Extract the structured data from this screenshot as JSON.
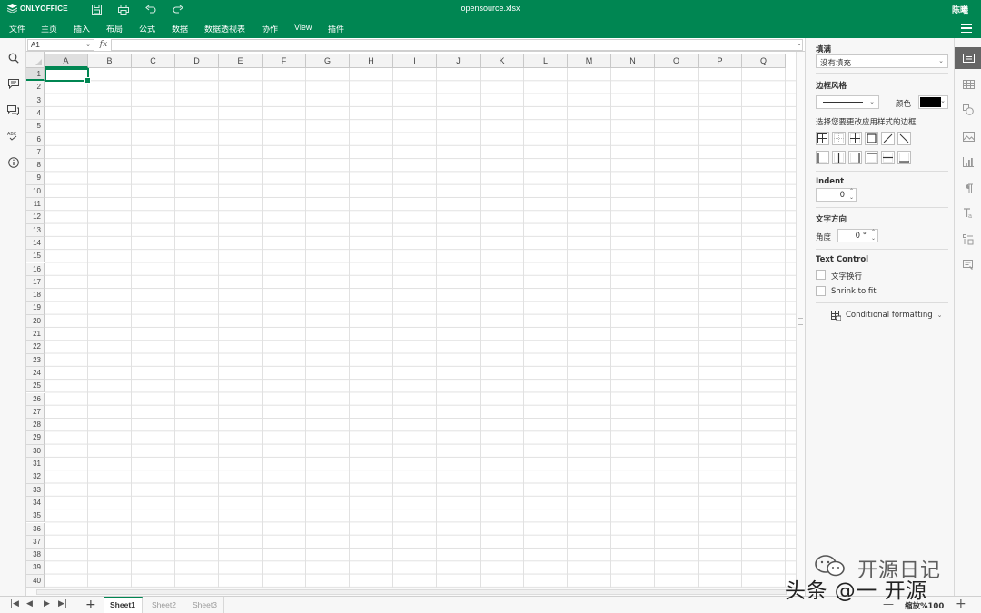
{
  "app": {
    "logo_text": "ONLYOFFICE",
    "doc_title": "opensource.xlsx",
    "user_name": "陈曦",
    "brand_color": "#008652"
  },
  "menu": {
    "items": [
      "文件",
      "主页",
      "插入",
      "布局",
      "公式",
      "数据",
      "数据透视表",
      "协作",
      "View",
      "插件"
    ]
  },
  "formula_bar": {
    "cell_ref": "A1",
    "fx_label": "fx",
    "formula": ""
  },
  "grid": {
    "columns": [
      "A",
      "B",
      "C",
      "D",
      "E",
      "F",
      "G",
      "H",
      "I",
      "J",
      "K",
      "L",
      "M",
      "N",
      "O",
      "P",
      "Q"
    ],
    "rows": [
      "1",
      "2",
      "3",
      "4",
      "5",
      "6",
      "7",
      "8",
      "9",
      "10",
      "11",
      "12",
      "13",
      "14",
      "15",
      "16",
      "17",
      "18",
      "19",
      "20",
      "21",
      "22",
      "23",
      "24",
      "25",
      "26",
      "27",
      "28",
      "29",
      "30",
      "31",
      "32",
      "33",
      "34",
      "35",
      "36",
      "37",
      "38",
      "39",
      "40"
    ],
    "selected_cell": "A1"
  },
  "right_panel": {
    "fill_label": "填满",
    "fill_value": "没有填充",
    "border_style_label": "边框风格",
    "color_label": "颜色",
    "border_color": "#000000",
    "border_apply_label": "选择您要更改应用样式的边框",
    "indent_label": "Indent",
    "indent_value": "0",
    "text_direction_label": "文字方向",
    "angle_label": "角度",
    "angle_value": "0 °",
    "text_control_label": "Text Control",
    "wrap_text_label": "文字换行",
    "shrink_label": "Shrink to fit",
    "conditional_formatting_label": "Conditional formatting"
  },
  "sheets": {
    "tabs": [
      "Sheet1",
      "Sheet2",
      "Sheet3"
    ],
    "active": "Sheet1"
  },
  "status": {
    "zoom_label": "缩放%100"
  },
  "watermark": {
    "top_text": "开源日记",
    "bottom_text": "头条 @一 开源"
  }
}
